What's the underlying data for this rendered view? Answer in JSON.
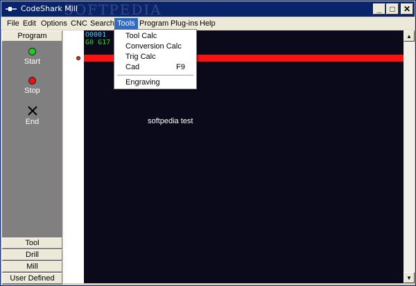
{
  "window": {
    "title": "CodeShark Mill",
    "watermark": "SOFTPEDIA",
    "minimize": "_",
    "maximize": "□",
    "close": "✕"
  },
  "menu": {
    "items": [
      "File",
      "Edit",
      "Options",
      "CNC",
      "Search",
      "Tools",
      "Program",
      "Plug-ins",
      "Help"
    ],
    "active": "Tools"
  },
  "tools_menu": {
    "items": [
      {
        "label": "Tool Calc",
        "shortcut": ""
      },
      {
        "label": "Conversion Calc",
        "shortcut": ""
      },
      {
        "label": "Trig Calc",
        "shortcut": ""
      },
      {
        "label": "Cad",
        "shortcut": "F9"
      },
      {
        "label": "Engraving",
        "shortcut": ""
      }
    ]
  },
  "left_panel": {
    "program_tab": "Program",
    "start": "Start",
    "stop": "Stop",
    "end": "End",
    "tool_tab": "Tool",
    "drill_tab": "Drill",
    "mill_tab": "Mill",
    "user_defined_tab": "User Defined"
  },
  "editor": {
    "line1": "O0001",
    "line2": "G0 G17 G",
    "overlay": "softpedia test"
  },
  "colors": {
    "start_led": "#22cc22",
    "stop_led": "#ee1111",
    "highlight": "#ff1010",
    "editor_bg": "#0a0a1a"
  }
}
